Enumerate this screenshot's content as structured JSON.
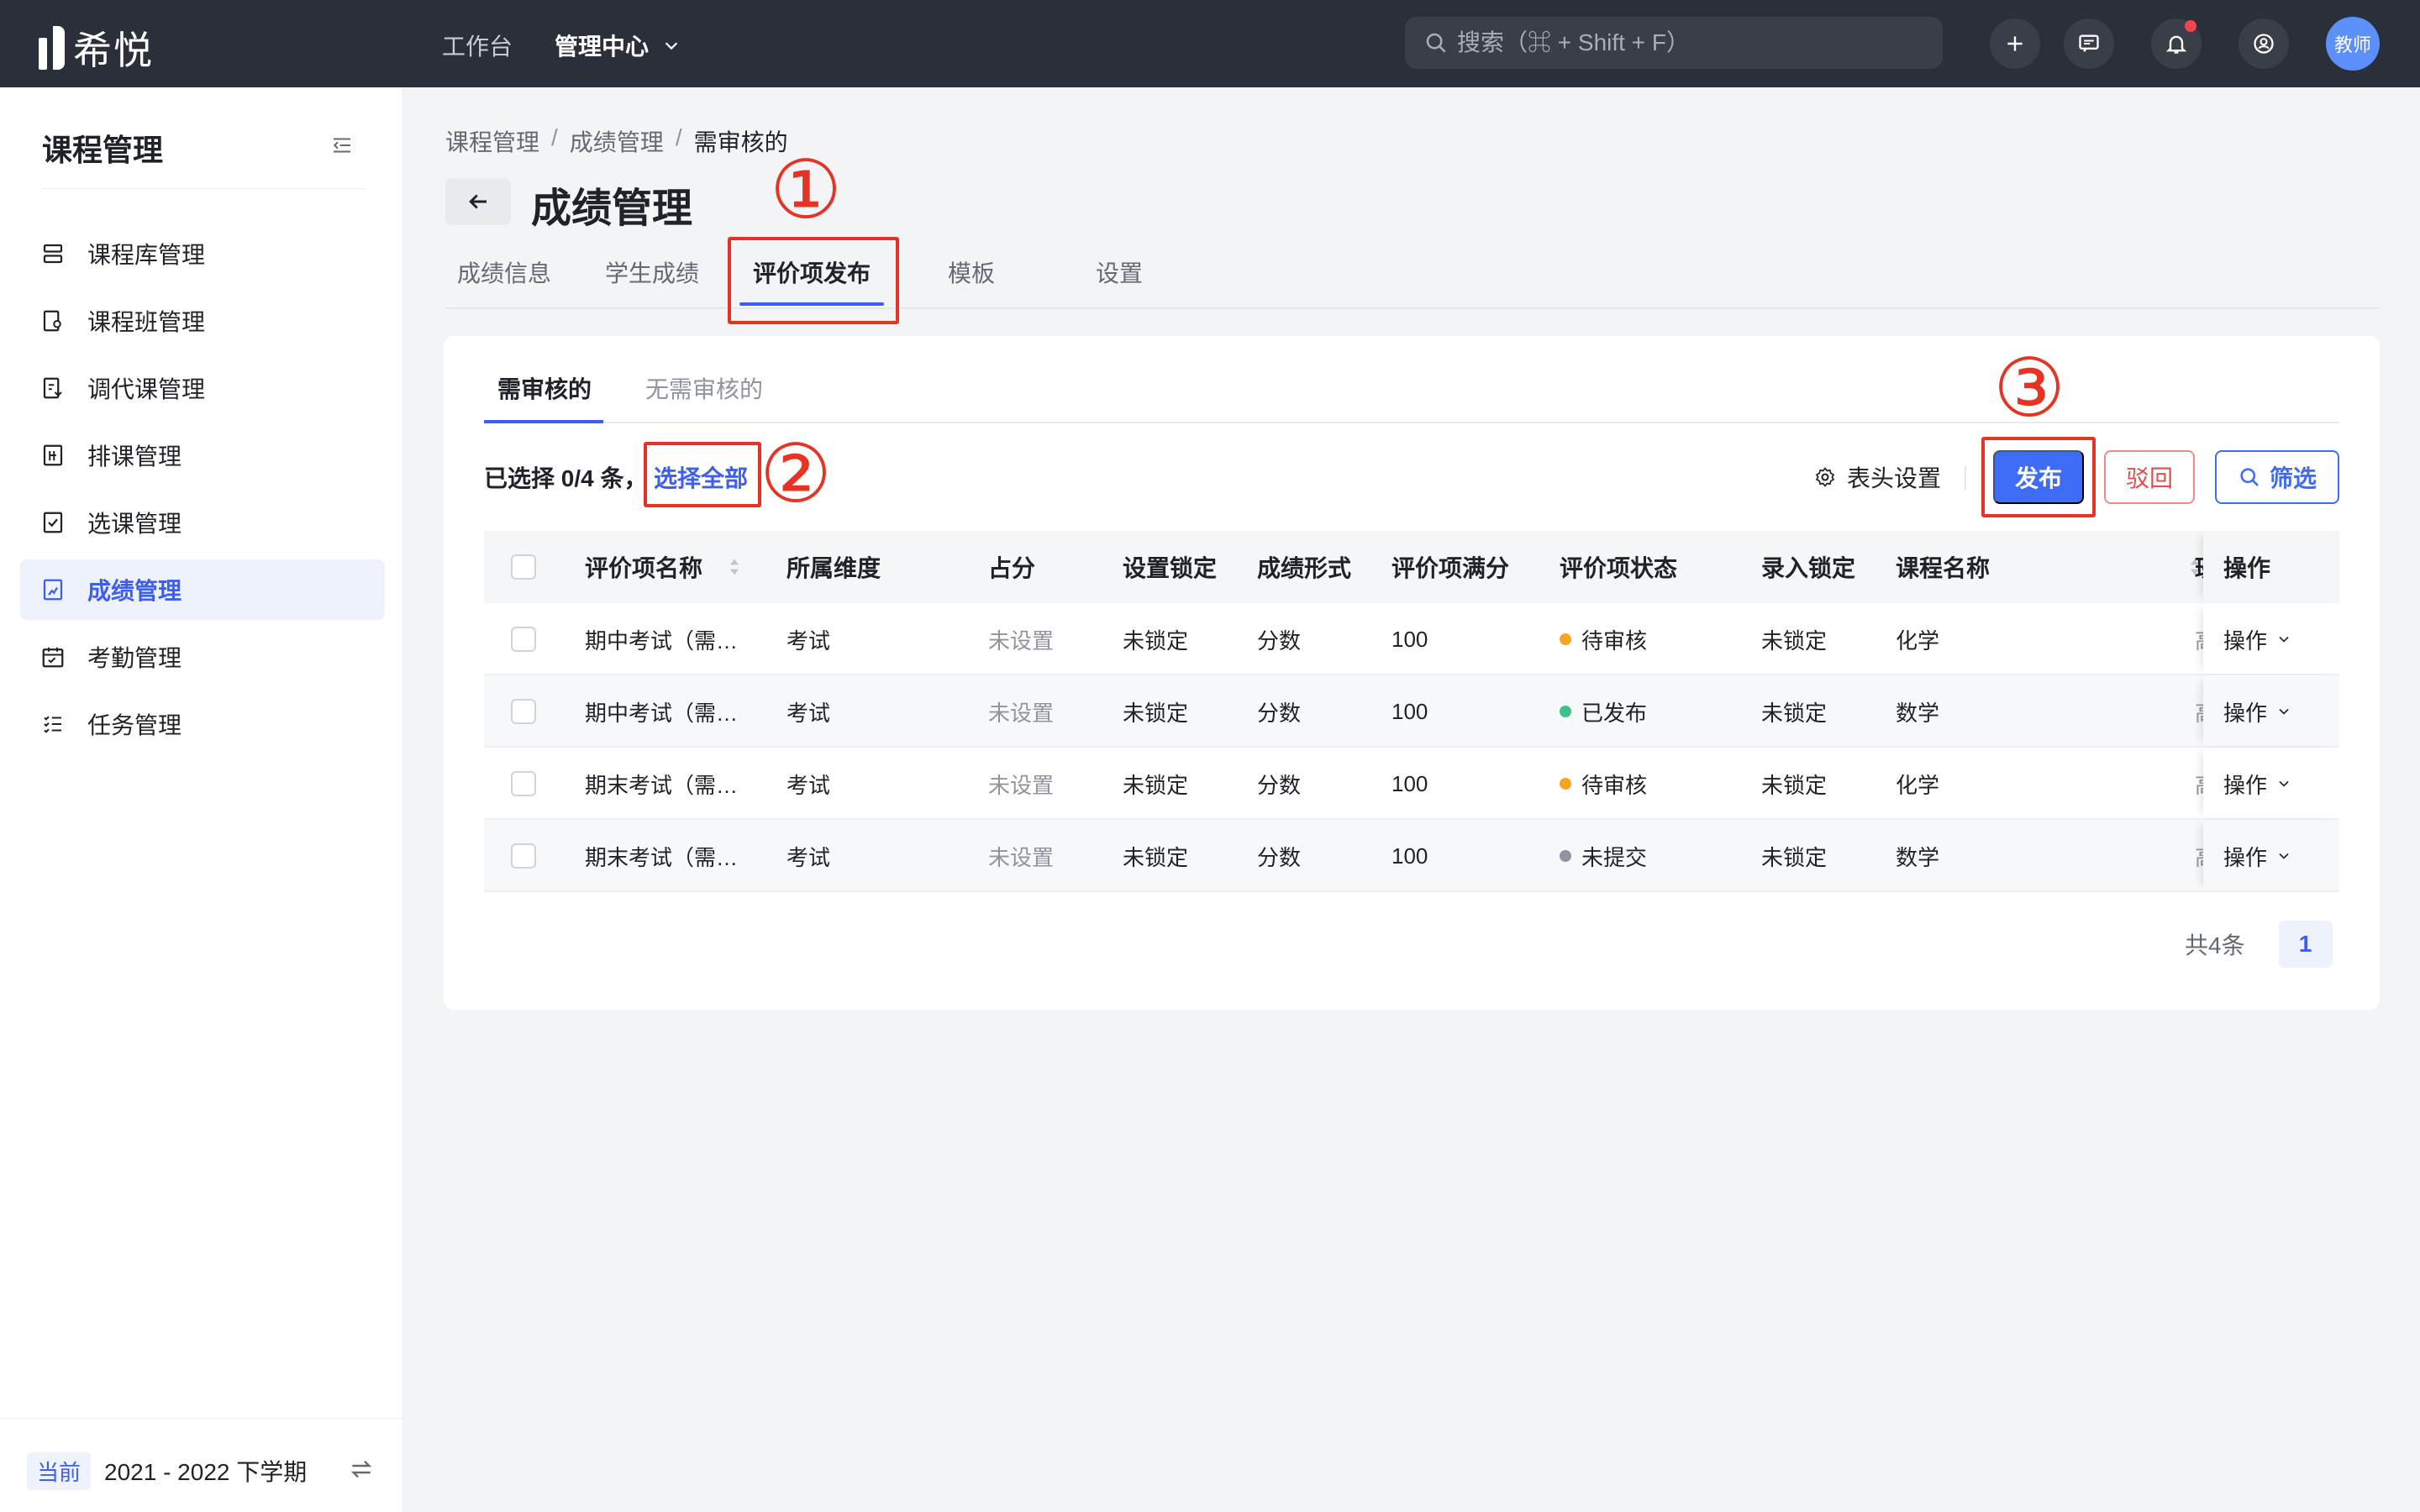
{
  "topbar": {
    "logo_text": "希悦",
    "nav": [
      {
        "label": "工作台",
        "active": false
      },
      {
        "label": "管理中心",
        "active": true
      }
    ],
    "search_placeholder": "搜索（⌘ + Shift + F）",
    "avatar_label": "教师",
    "icons": [
      "plus-icon",
      "message-icon",
      "bell-icon",
      "user-switch-icon"
    ]
  },
  "sidebar": {
    "title": "课程管理",
    "items": [
      {
        "label": "课程库管理",
        "icon": "list-icon",
        "active": false
      },
      {
        "label": "课程班管理",
        "icon": "class-icon",
        "active": false
      },
      {
        "label": "调代课管理",
        "icon": "swap-class-icon",
        "active": false
      },
      {
        "label": "排课管理",
        "icon": "schedule-icon",
        "active": false
      },
      {
        "label": "选课管理",
        "icon": "select-course-icon",
        "active": false
      },
      {
        "label": "成绩管理",
        "icon": "grade-icon",
        "active": true
      },
      {
        "label": "考勤管理",
        "icon": "calendar-icon",
        "active": false
      },
      {
        "label": "任务管理",
        "icon": "task-icon",
        "active": false
      }
    ],
    "footer": {
      "badge": "当前",
      "term": "2021 - 2022 下学期"
    }
  },
  "breadcrumb": [
    "课程管理",
    "成绩管理",
    "需审核的"
  ],
  "page_title": "成绩管理",
  "main_tabs": [
    {
      "label": "成绩信息",
      "active": false
    },
    {
      "label": "学生成绩",
      "active": false
    },
    {
      "label": "评价项发布",
      "active": true
    },
    {
      "label": "模板",
      "active": false
    },
    {
      "label": "设置",
      "active": false
    }
  ],
  "sub_tabs": [
    {
      "label": "需审核的",
      "active": true
    },
    {
      "label": "无需审核的",
      "active": false
    }
  ],
  "toolbar": {
    "selected_text": "已选择 0/4 条，",
    "select_all": "选择全部",
    "header_settings": "表头设置",
    "publish": "发布",
    "reject": "驳回",
    "filter": "筛选"
  },
  "table": {
    "columns": [
      "评价项名称",
      "所属维度",
      "占分",
      "设置锁定",
      "成绩形式",
      "评价项满分",
      "评价项状态",
      "录入锁定",
      "课程名称",
      "班",
      "操作"
    ],
    "rows": [
      {
        "name": "期中考试（需…",
        "dimension": "考试",
        "score": "未设置",
        "setting_lock": "未锁定",
        "form": "分数",
        "full": "100",
        "status": "待审核",
        "status_color": "#f5a623",
        "entry_lock": "未锁定",
        "course": "化学",
        "cls": "高",
        "op": "操作"
      },
      {
        "name": "期中考试（需…",
        "dimension": "考试",
        "score": "未设置",
        "setting_lock": "未锁定",
        "form": "分数",
        "full": "100",
        "status": "已发布",
        "status_color": "#3fc28a",
        "entry_lock": "未锁定",
        "course": "数学",
        "cls": "高",
        "op": "操作"
      },
      {
        "name": "期末考试（需…",
        "dimension": "考试",
        "score": "未设置",
        "setting_lock": "未锁定",
        "form": "分数",
        "full": "100",
        "status": "待审核",
        "status_color": "#f5a623",
        "entry_lock": "未锁定",
        "course": "化学",
        "cls": "高",
        "op": "操作"
      },
      {
        "name": "期末考试（需…",
        "dimension": "考试",
        "score": "未设置",
        "setting_lock": "未锁定",
        "form": "分数",
        "full": "100",
        "status": "未提交",
        "status_color": "#8f959e",
        "entry_lock": "未锁定",
        "course": "数学",
        "cls": "高",
        "op": "操作"
      }
    ]
  },
  "pagination": {
    "total": "共4条",
    "current": "1"
  },
  "annotations": [
    "①",
    "②",
    "③"
  ]
}
